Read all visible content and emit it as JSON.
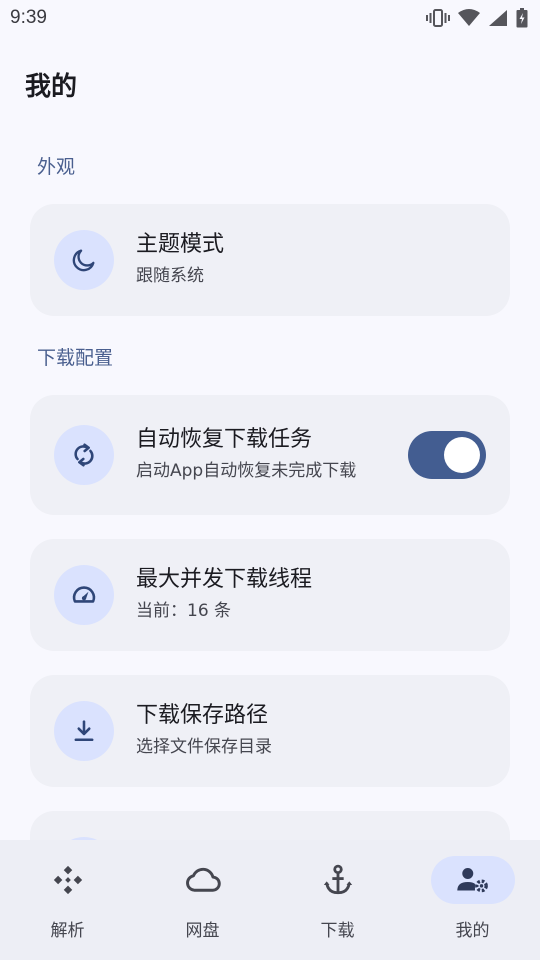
{
  "status_bar": {
    "time": "9:39",
    "icons": [
      "vibrate-icon",
      "wifi-icon",
      "cell-signal-icon",
      "battery-icon"
    ]
  },
  "page": {
    "title": "我的"
  },
  "sections": {
    "appearance": {
      "header": "外观"
    },
    "download_config": {
      "header": "下载配置"
    }
  },
  "cards": {
    "theme": {
      "icon": "moon-icon",
      "title": "主题模式",
      "subtitle": "跟随系统"
    },
    "auto_resume": {
      "icon": "sync-icon",
      "title": "自动恢复下载任务",
      "subtitle": "启动App自动恢复未完成下载",
      "toggle_on": true
    },
    "max_threads": {
      "icon": "speedometer-icon",
      "title": "最大并发下载线程",
      "subtitle": "当前：16 条"
    },
    "save_path": {
      "icon": "download-icon",
      "title": "下载保存路径",
      "subtitle": "选择文件保存目录"
    }
  },
  "bottom_nav": {
    "items": [
      {
        "icon": "parse-icon",
        "label": "解析"
      },
      {
        "icon": "cloud-icon",
        "label": "网盘"
      },
      {
        "icon": "anchor-icon",
        "label": "下载"
      },
      {
        "icon": "user-settings-icon",
        "label": "我的",
        "active": true
      }
    ]
  },
  "colors": {
    "background": "#f8f8fe",
    "card": "#eff0f6",
    "icon_circle": "#dae2fe",
    "accent": "#435d91",
    "section_header": "#4a5f8f",
    "nav_bar": "#edeef5"
  }
}
